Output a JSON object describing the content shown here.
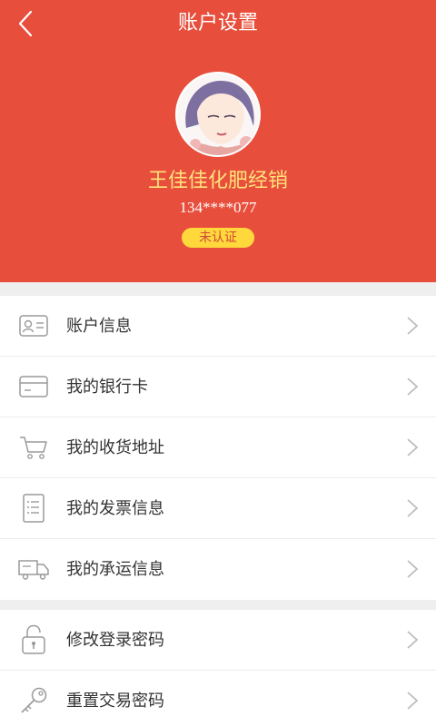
{
  "header": {
    "title": "账户设置",
    "back_icon": "chevron-left-icon",
    "background_color": "#e84e3c"
  },
  "profile": {
    "name": "王佳佳化肥经销",
    "phone": "134****077",
    "status_badge": "未认证",
    "name_color": "#ffe27a",
    "badge_color": "#ffd93b"
  },
  "menu_group_1": [
    {
      "label": "账户信息",
      "icon": "id-card-icon"
    },
    {
      "label": "我的银行卡",
      "icon": "bank-card-icon"
    },
    {
      "label": "我的收货地址",
      "icon": "cart-icon"
    },
    {
      "label": "我的发票信息",
      "icon": "invoice-icon"
    },
    {
      "label": "我的承运信息",
      "icon": "truck-icon"
    }
  ],
  "menu_group_2": [
    {
      "label": "修改登录密码",
      "icon": "lock-icon"
    },
    {
      "label": "重置交易密码",
      "icon": "key-icon"
    }
  ]
}
